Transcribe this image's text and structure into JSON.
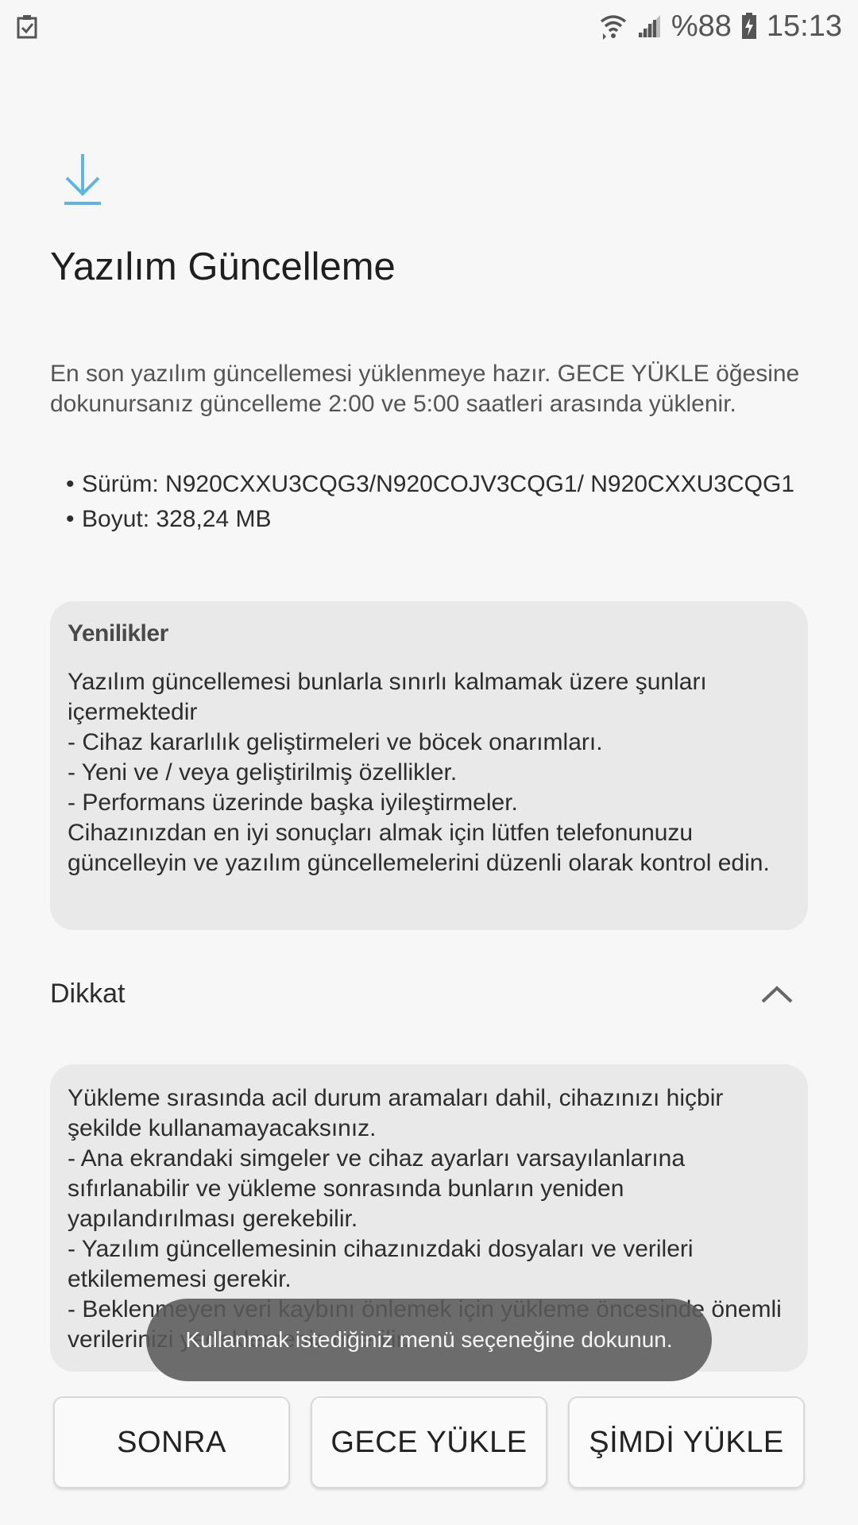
{
  "status_bar": {
    "battery_text": "%88",
    "time": "15:13",
    "icons": [
      "task-check-icon",
      "wifi-icon",
      "signal-icon",
      "battery-charging-icon"
    ]
  },
  "colors": {
    "accent_blue": "#5fb6dd",
    "background": "#f7f7f7",
    "card_background": "#e9e9e9",
    "toast_background": "#5a5a5a"
  },
  "header": {
    "icon": "download-icon",
    "title": "Yazılım Güncelleme"
  },
  "intro_text": "En son yazılım güncellemesi yüklenmeye hazır. GECE YÜKLE öğesine dokunursanız güncelleme 2:00 ve 5:00 saatleri arasında yüklenir.",
  "details": {
    "version": "Sürüm: N920CXXU3CQG3/N920COJV3CQG1/ N920CXXU3CQG1",
    "size": "Boyut: 328,24 MB"
  },
  "whats_new": {
    "title": "Yenilikler",
    "body": "Yazılım güncellemesi bunlarla sınırlı kalmamak üzere şunları içermektedir\n - Cihaz kararlılık geliştirmeleri ve böcek onarımları.\n - Yeni ve / veya geliştirilmiş özellikler.\n - Performans üzerinde başka iyileştirmeler.\nCihazınızdan en iyi sonuçları almak için lütfen telefonunuzu güncelleyin ve yazılım güncellemelerini düzenli olarak kontrol edin."
  },
  "caution": {
    "title": "Dikkat",
    "body": "Yükleme sırasında acil durum aramaları dahil, cihazınızı hiçbir şekilde kullanamayacaksınız.\n- Ana ekrandaki simgeler ve cihaz ayarları varsayılanlarına sıfırlanabilir ve yükleme sonrasında bunların yeniden yapılandırılması gerekebilir.\n- Yazılım güncellemesinin cihazınızdaki dosyaları ve verileri etkilememesi gerekir.\n- Beklenmeyen veri kaybını önlemek için yükleme öncesinde önemli verilerinizi yedeklemeniz önerilir."
  },
  "toast": "Kullanmak istediğiniz menü seçeneğine dokunun.",
  "buttons": {
    "later": "SONRA",
    "install_overnight": "GECE YÜKLE",
    "install_now": "ŞİMDİ YÜKLE"
  }
}
